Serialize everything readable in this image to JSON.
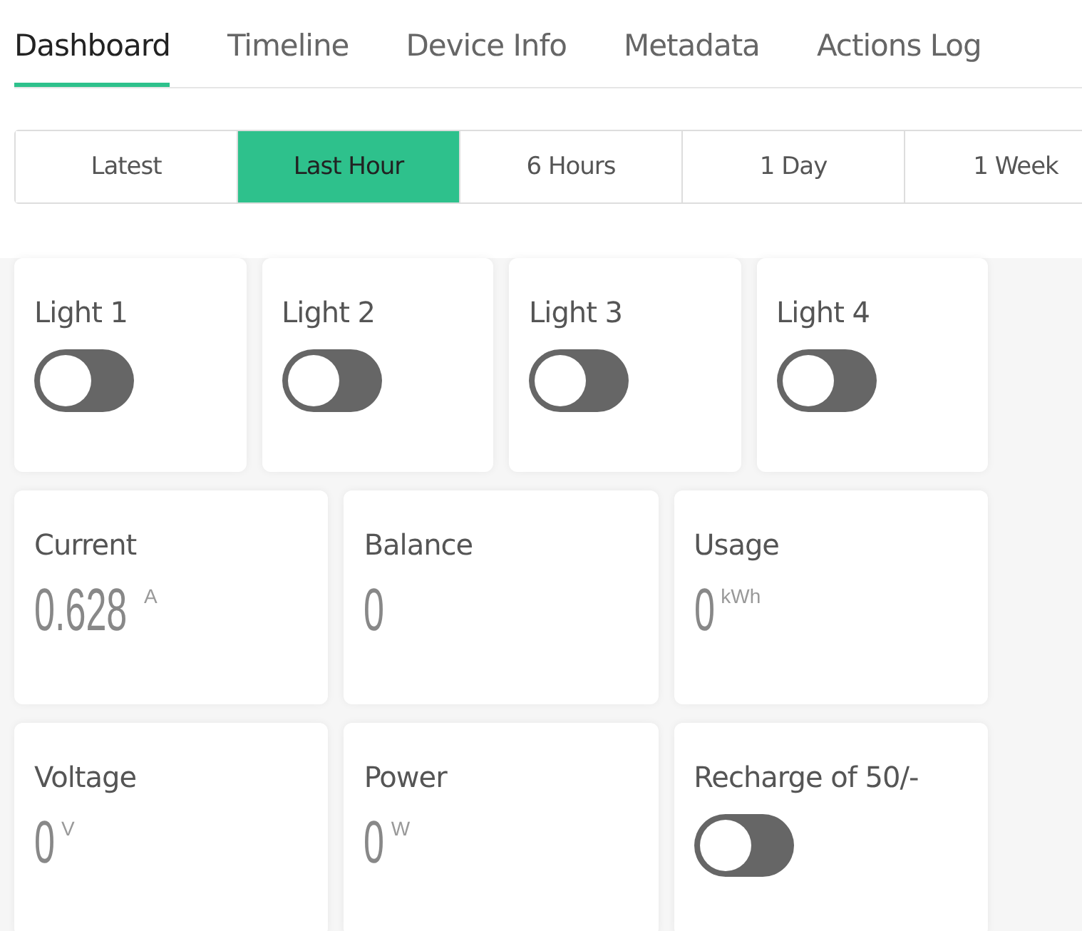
{
  "tabs": [
    {
      "label": "Dashboard",
      "selected": true
    },
    {
      "label": "Timeline",
      "selected": false
    },
    {
      "label": "Device Info",
      "selected": false
    },
    {
      "label": "Metadata",
      "selected": false
    },
    {
      "label": "Actions Log",
      "selected": false
    }
  ],
  "ranges": [
    {
      "label": "Latest",
      "selected": false
    },
    {
      "label": "Last Hour",
      "selected": true
    },
    {
      "label": "6 Hours",
      "selected": false
    },
    {
      "label": "1 Day",
      "selected": false
    },
    {
      "label": "1 Week",
      "selected": false
    }
  ],
  "widget_rows": [
    [
      {
        "kind": "switch",
        "title": "Light 1",
        "on": false
      },
      {
        "kind": "switch",
        "title": "Light 2",
        "on": false
      },
      {
        "kind": "switch",
        "title": "Light 3",
        "on": false
      },
      {
        "kind": "switch",
        "title": "Light 4",
        "on": false
      }
    ],
    [
      {
        "kind": "value",
        "title": "Current",
        "value": "0.628",
        "unit": "A"
      },
      {
        "kind": "value",
        "title": "Balance",
        "value": "0"
      },
      {
        "kind": "value",
        "title": "Usage",
        "value": "0",
        "unit": "kWh"
      }
    ],
    [
      {
        "kind": "value",
        "title": "Voltage",
        "value": "0",
        "unit": "V"
      },
      {
        "kind": "value",
        "title": "Power",
        "value": "0",
        "unit": "W"
      },
      {
        "kind": "switch",
        "title": "Recharge of 50/-",
        "on": false
      }
    ]
  ]
}
